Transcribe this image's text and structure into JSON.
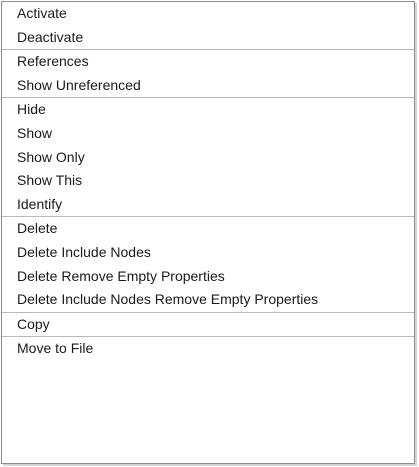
{
  "menu": {
    "groups": [
      {
        "items": [
          {
            "label": "Activate"
          },
          {
            "label": "Deactivate"
          }
        ]
      },
      {
        "items": [
          {
            "label": "References"
          },
          {
            "label": "Show Unreferenced"
          }
        ]
      },
      {
        "items": [
          {
            "label": "Hide"
          },
          {
            "label": "Show"
          },
          {
            "label": "Show Only"
          },
          {
            "label": "Show This"
          },
          {
            "label": "Identify"
          }
        ]
      },
      {
        "items": [
          {
            "label": "Delete"
          },
          {
            "label": "Delete Include Nodes"
          },
          {
            "label": "Delete Remove Empty Properties"
          },
          {
            "label": "Delete Include Nodes Remove Empty Properties"
          }
        ]
      },
      {
        "items": [
          {
            "label": "Copy"
          }
        ]
      },
      {
        "items": [
          {
            "label": "Move to File"
          }
        ]
      }
    ]
  }
}
